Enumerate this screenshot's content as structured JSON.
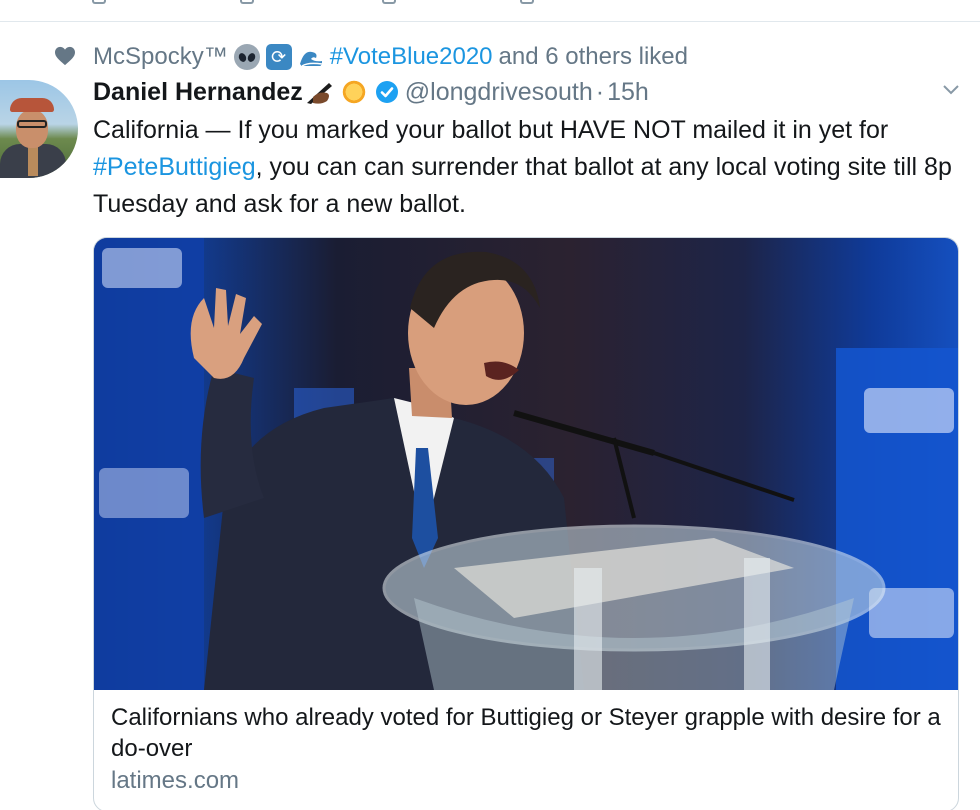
{
  "social_context": {
    "liked_by": "McSpocky™",
    "hashtag": "#VoteBlue2020",
    "rest": "and 6 others liked"
  },
  "author": {
    "display_name": "Daniel Hernandez",
    "handle": "@longdrivesouth",
    "separator": "·",
    "time": "15h"
  },
  "tweet": {
    "text_before": "California — If you marked your ballot but HAVE NOT mailed it in yet for ",
    "hashtag": "#PeteButtigieg",
    "text_after": ", you can can surrender that ballot at any local voting site till 8p Tuesday and ask for a new ballot."
  },
  "card": {
    "title": "Californians who already voted for Buttigieg or Steyer grapple with desire for a do-over",
    "domain": "latimes.com"
  },
  "colors": {
    "link": "#1b95e0",
    "secondary_text": "#657786",
    "border": "#ccd6dd",
    "verified": "#1da1f2"
  },
  "icons": [
    "heart-icon",
    "alien-icon",
    "repeat-icon",
    "wave-icon",
    "writing-hand-icon",
    "sun-icon",
    "verified-icon",
    "caret-down-icon"
  ]
}
